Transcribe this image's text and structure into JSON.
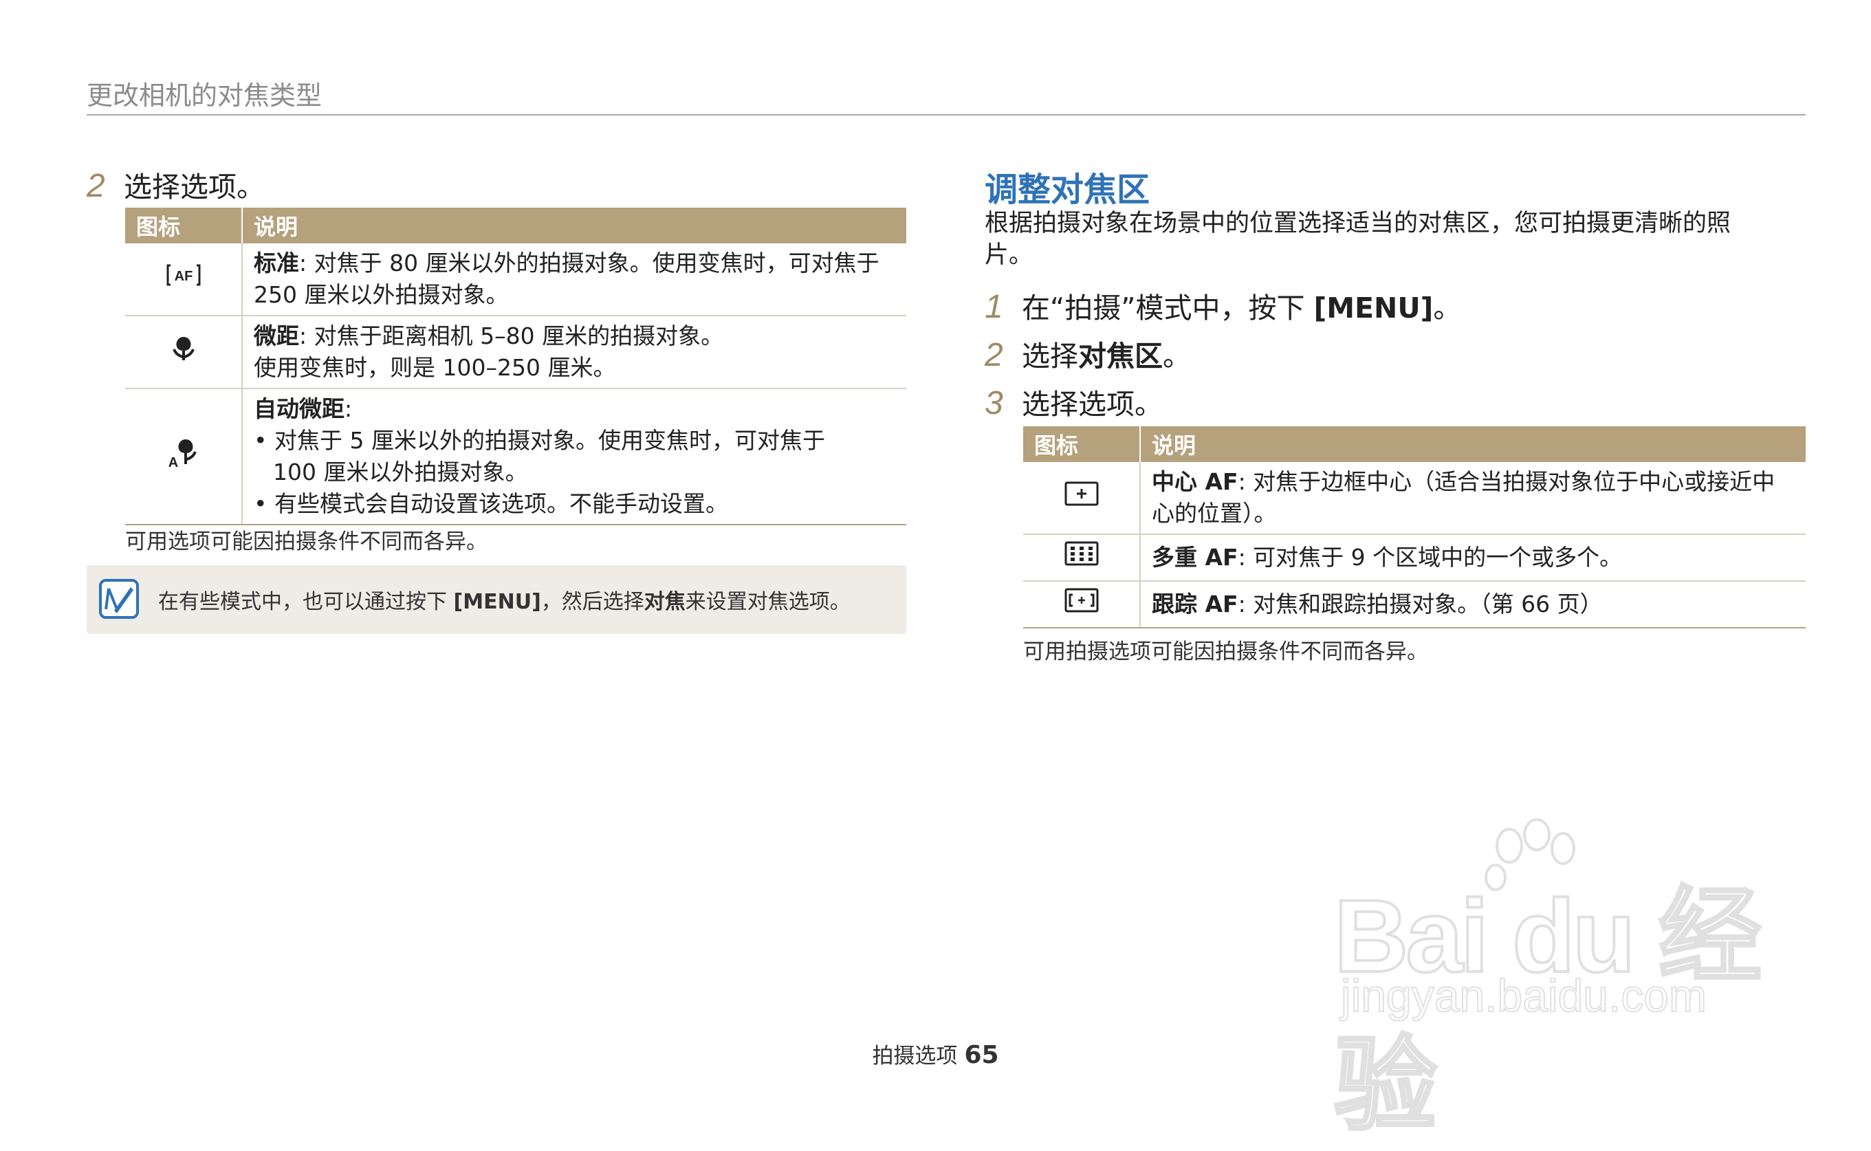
{
  "header": {
    "title": "更改相机的对焦类型"
  },
  "left": {
    "step": {
      "number": "2",
      "text": "选择选项。"
    },
    "table": {
      "headers": [
        "图标",
        "说明"
      ],
      "rows": [
        {
          "icon": "af-standard-icon",
          "term": "标准",
          "lines": [
            ": 对焦于 80 厘米以外的拍摄对象。使用变焦时，可对焦于",
            "250 厘米以外拍摄对象。"
          ]
        },
        {
          "icon": "macro-icon",
          "term": "微距",
          "lines": [
            ": 对焦于距离相机 5–80 厘米的拍摄对象。",
            "使用变焦时，则是 100–250 厘米。"
          ]
        },
        {
          "icon": "auto-macro-icon",
          "term": "自动微距",
          "colon": ":",
          "bullets": [
            [
              "对焦于 5 厘米以外的拍摄对象。使用变焦时，可对焦于",
              "100 厘米以外拍摄对象。"
            ],
            [
              "有些模式会自动设置该选项。不能手动设置。"
            ]
          ]
        }
      ]
    },
    "note": "可用选项可能因拍摄条件不同而各异。",
    "tip": {
      "icon": "note-pencil-icon",
      "pre": "在有些模式中，也可以通过按下 ",
      "key": "[MENU]",
      "mid": "，然后选择",
      "term": "对焦",
      "post": "来设置对焦选项。"
    }
  },
  "right": {
    "section_title": "调整对焦区",
    "section_desc": "根据拍摄对象在场景中的位置选择适当的对焦区，您可拍摄更清晰的照片。",
    "steps": [
      {
        "number": "1",
        "pre": "在“拍摄”模式中，按下 ",
        "key": "[MENU]",
        "post": "。"
      },
      {
        "number": "2",
        "pre": "选择",
        "term": "对焦区",
        "post": "。"
      },
      {
        "number": "3",
        "pre": "选择选项。"
      }
    ],
    "table": {
      "headers": [
        "图标",
        "说明"
      ],
      "rows": [
        {
          "icon": "center-af-icon",
          "term": "中心 AF",
          "lines": [
            ": 对焦于边框中心（适合当拍摄对象位于中心或接近中",
            "心的位置）。"
          ]
        },
        {
          "icon": "multi-af-icon",
          "term": "多重 AF",
          "lines": [
            ": 可对焦于 9 个区域中的一个或多个。"
          ]
        },
        {
          "icon": "tracking-af-icon",
          "term": "跟踪 AF",
          "lines": [
            ": 对焦和跟踪拍摄对象。（第 66 页）"
          ]
        }
      ]
    },
    "note": "可用拍摄选项可能因拍摄条件不同而各异。"
  },
  "footer": {
    "section": "拍摄选项",
    "page": "65"
  },
  "watermark": {
    "logo": "Bai du 经验",
    "url": "jingyan.baidu.com"
  },
  "colors": {
    "table_header": "#b6a17d",
    "section_title": "#2f73b6",
    "tip_bg": "#efebe5",
    "step_number": "#a08a64"
  }
}
